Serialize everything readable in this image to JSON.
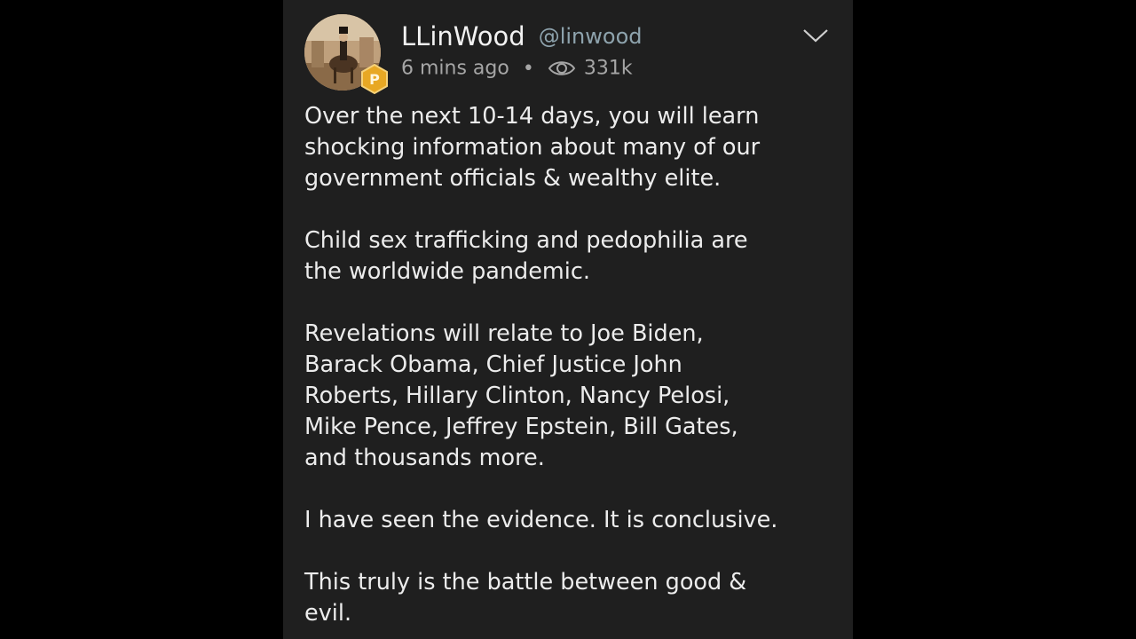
{
  "post": {
    "display_name": "LLinWood",
    "handle": "@linwood",
    "time_ago": "6 mins ago",
    "separator": "•",
    "views": "331k",
    "paragraphs": [
      "Over the next 10-14 days, you will learn\nshocking information about many of our\ngovernment officials & wealthy elite.",
      "Child sex trafficking and pedophilia are\nthe worldwide pandemic.",
      "Revelations will relate to Joe Biden,\nBarack Obama, Chief Justice John\nRoberts, Hillary Clinton, Nancy Pelosi,\nMike Pence, Jeffrey Epstein, Bill Gates,\nand thousands more.",
      "I have seen the evidence. It is conclusive.",
      "This truly is the battle between good &\nevil."
    ],
    "icons": {
      "avatar": "user-avatar",
      "badge": "verified-badge-icon",
      "views": "eye-icon",
      "menu": "chevron-down-icon"
    }
  },
  "colors": {
    "background": "#000000",
    "card": "#1f1f1f",
    "text": "#ececec",
    "handle": "#8ea3ad",
    "meta": "#a6a6a6",
    "badge": "#e8a824"
  }
}
